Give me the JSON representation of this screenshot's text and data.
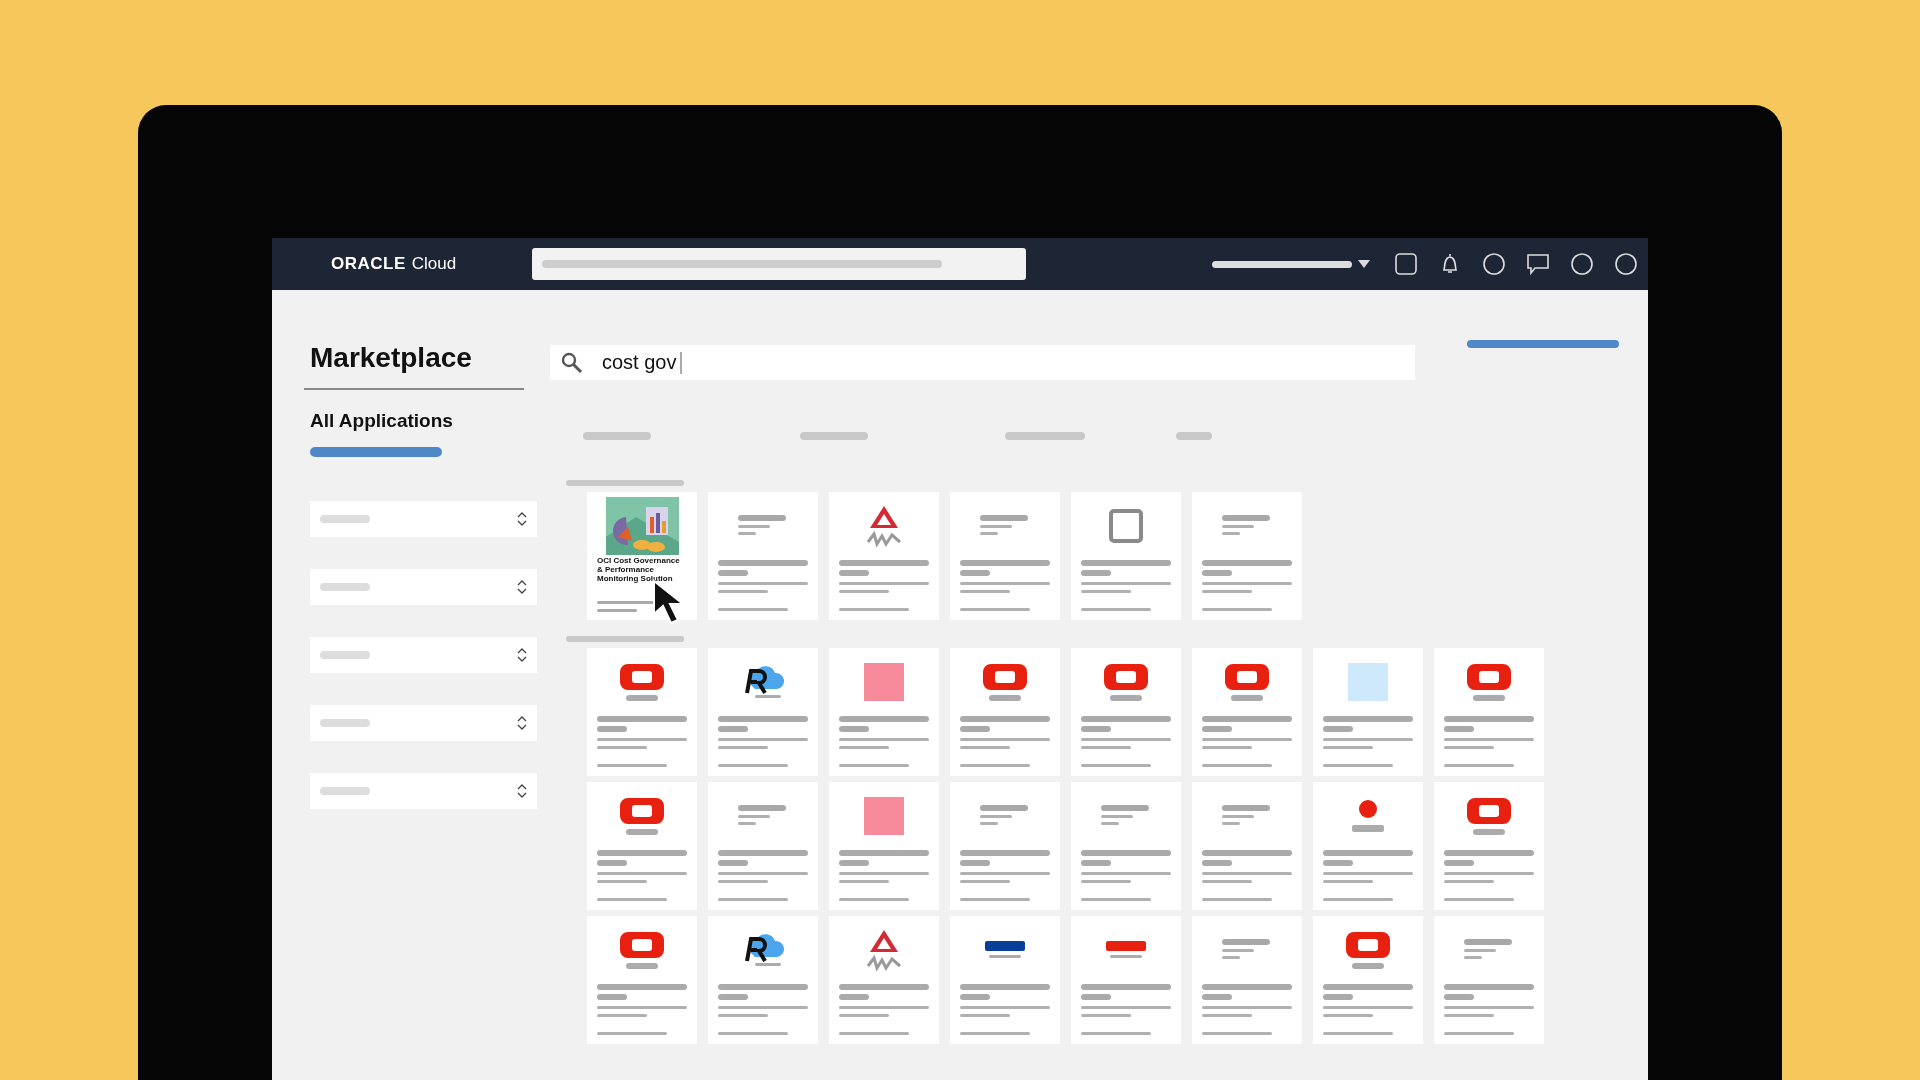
{
  "topbar": {
    "brand": "ORACLE",
    "product": "Cloud"
  },
  "sidebar": {
    "title": "Marketplace",
    "section": "All Applications"
  },
  "search": {
    "value": "cost gov"
  },
  "featured": [
    {
      "kind": "image",
      "caption": "OCI Cost Governance & Performance Monitoring Solution",
      "pointer": true
    },
    {
      "kind": "lines"
    },
    {
      "kind": "triangle"
    },
    {
      "kind": "lines"
    },
    {
      "kind": "outline-square"
    },
    {
      "kind": "lines"
    }
  ],
  "results": [
    {
      "kind": "oracle"
    },
    {
      "kind": "r-cloud"
    },
    {
      "kind": "pink-square"
    },
    {
      "kind": "oracle"
    },
    {
      "kind": "oracle"
    },
    {
      "kind": "oracle"
    },
    {
      "kind": "light-square"
    },
    {
      "kind": "oracle"
    },
    {
      "kind": "oracle"
    },
    {
      "kind": "lines"
    },
    {
      "kind": "pink-square"
    },
    {
      "kind": "lines"
    },
    {
      "kind": "lines"
    },
    {
      "kind": "lines"
    },
    {
      "kind": "red-dot"
    },
    {
      "kind": "oracle"
    },
    {
      "kind": "oracle"
    },
    {
      "kind": "r-cloud"
    },
    {
      "kind": "triangle"
    },
    {
      "kind": "blue-bar"
    },
    {
      "kind": "red-bar"
    },
    {
      "kind": "lines"
    },
    {
      "kind": "oracle"
    },
    {
      "kind": "lines"
    }
  ]
}
